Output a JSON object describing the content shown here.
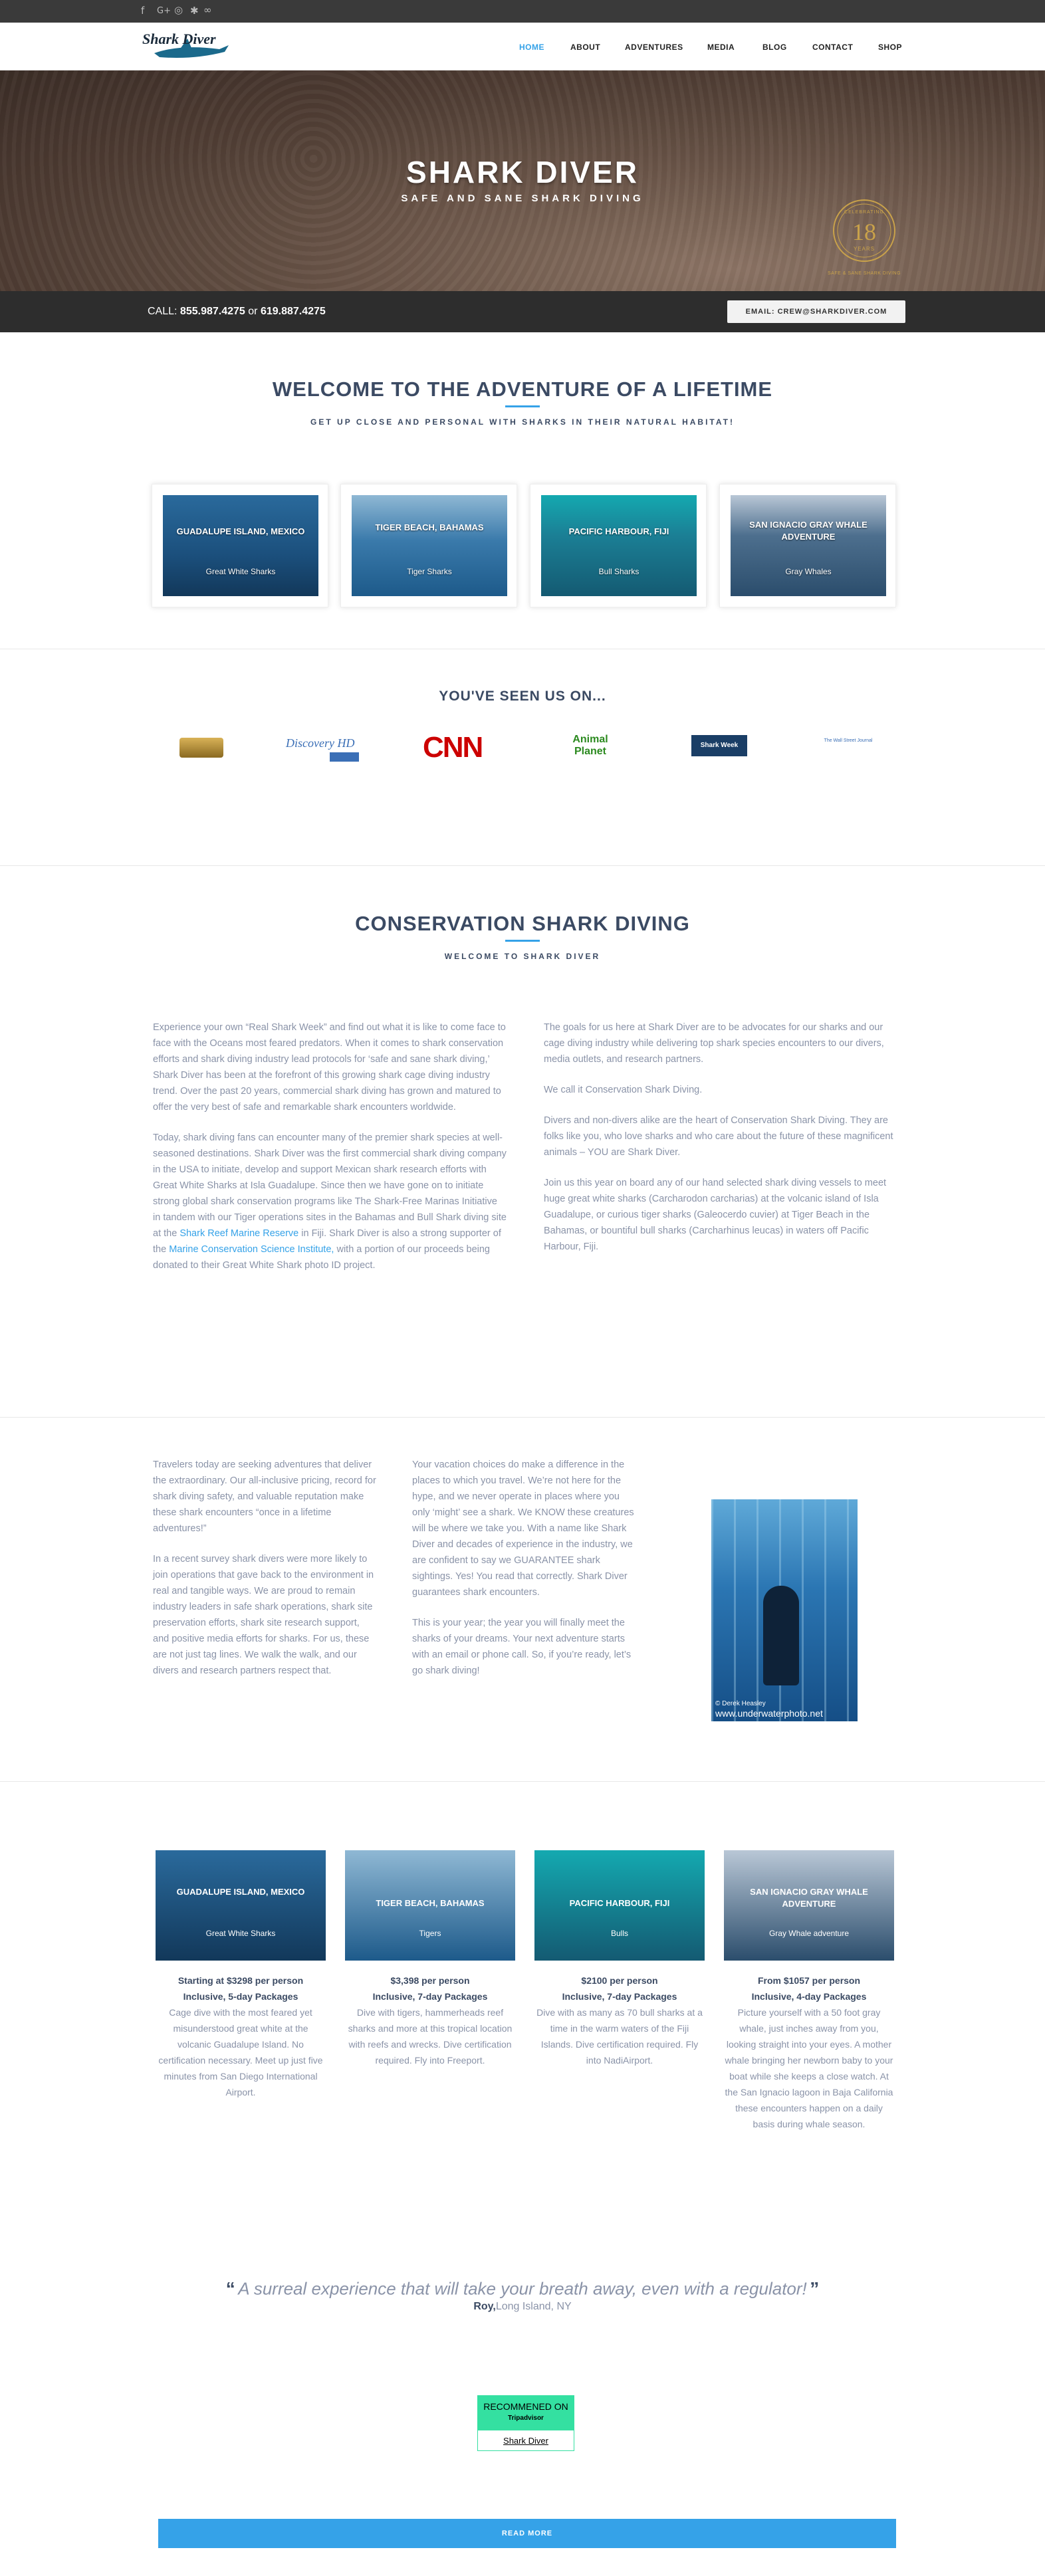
{
  "topbar": {
    "social_icons": [
      "facebook-icon",
      "google-plus-icon",
      "instagram-icon",
      "yelp-icon",
      "tripadvisor-icon"
    ]
  },
  "header": {
    "logo_text": "Shark Diver",
    "nav": [
      "HOME",
      "ABOUT",
      "ADVENTURES",
      "MEDIA",
      "BLOG",
      "CONTACT",
      "SHOP"
    ]
  },
  "hero": {
    "title": "SHARK DIVER",
    "subtitle": "SAFE AND SANE SHARK DIVING",
    "badge_top": "CELEBRATING",
    "badge_number": "18",
    "badge_years": "YEARS",
    "badge_bottom": "SAFE & SANE SHARK DIVING"
  },
  "callbar": {
    "call_label": "CALL:",
    "phone1": "855.987.4275",
    "or": "or",
    "phone2": "619.887.4275",
    "email_button": "EMAIL: CREW@SHARKDIVER.COM"
  },
  "welcome": {
    "title": "WELCOME TO THE ADVENTURE OF A LIFETIME",
    "subtitle": "GET UP CLOSE AND PERSONAL WITH SHARKS IN THEIR NATURAL HABITAT!"
  },
  "destinations": [
    {
      "title": "GUADALUPE ISLAND, MEXICO",
      "sub": "Great White Sharks"
    },
    {
      "title": "TIGER BEACH, BAHAMAS",
      "sub": "Tiger Sharks"
    },
    {
      "title": "PACIFIC HARBOUR, FIJI",
      "sub": "Bull Sharks"
    },
    {
      "title": "SAN IGNACIO GRAY WHALE ADVENTURE",
      "sub": "Gray Whales"
    }
  ],
  "seen": {
    "title": "YOU'VE SEEN US ON...",
    "logos": [
      "Discovery HD",
      "CNN",
      "Animal Planet",
      "Shark Week",
      "The Wall Street Journal"
    ]
  },
  "conservation": {
    "title": "CONSERVATION SHARK DIVING",
    "subtitle": "WELCOME TO SHARK DIVER",
    "left_p1": "Experience your own “Real Shark Week” and find out what it is like to come face to face with the Oceans most feared predators. When it comes to shark conservation efforts and shark diving industry lead protocols for ‘safe and sane shark diving,’ Shark Diver has been at the forefront of this growing shark cage diving industry trend. Over the past 20 years, commercial shark diving has grown and matured to offer the very best of safe and remarkable shark encounters worldwide.",
    "left_p2a": "Today, shark diving fans can encounter many of the premier shark species at well-seasoned destinations. Shark Diver was the first commercial shark diving company in the USA to initiate, develop and support Mexican shark research efforts with Great White Sharks at Isla Guadalupe. Since then we have gone on to initiate strong global shark conservation programs like The Shark-Free Marinas Initiative in tandem with our Tiger operations sites in the Bahamas and Bull Shark diving site at the",
    "link1": "Shark Reef Marine Reserve",
    "left_p2b": " in Fiji. Shark Diver is also a strong supporter of the ",
    "link2": "Marine Conservation Science Institute,",
    "left_p2c": " with a portion of our proceeds being donated to their Great White Shark photo ID project.",
    "right_p1": "The goals for us here at Shark Diver are to be advocates for our sharks and our cage diving industry while delivering top shark species encounters to our divers, media outlets, and research partners.",
    "right_p2": "We call it Conservation Shark Diving.",
    "right_p3": "Divers and non-divers alike are the heart of Conservation Shark Diving. They are folks like you, who love sharks and who care about the future of these magnificent animals – YOU are Shark Diver.",
    "right_p4": "Join us this year on board any of our hand selected shark diving vessels to meet huge great white sharks (Carcharodon carcharias) at the volcanic island of Isla Guadalupe, or curious tiger sharks (Galeocerdo cuvier) at Tiger Beach in the Bahamas, or bountiful bull sharks (Carcharhinus leucas) in waters off Pacific Harbour, Fiji."
  },
  "travel": {
    "c1_p1": "Travelers today are seeking adventures that deliver the extraordinary. Our all-inclusive pricing, record for shark diving safety, and valuable reputation make these shark encounters “once in a lifetime adventures!”",
    "c1_p2": "In a recent survey shark divers were more likely to join operations that gave back to the environment in real and tangible ways. We are proud to remain industry leaders in safe shark operations, shark site preservation efforts, shark site research support, and positive media efforts for sharks. For us, these are not just tag lines. We walk the walk, and our divers and research partners respect that.",
    "c2_p1": "Your vacation choices do make a difference in the places to which you travel. We’re not here for the hype, and we never operate in places where you only ‘might’ see a shark. We KNOW these creatures will be where we take you. With a name like Shark Diver and decades of experience in the industry, we are confident to say we GUARANTEE shark sightings. Yes! You read that correctly. Shark Diver guarantees shark encounters.",
    "c2_p2": "This is your year; the year you will finally meet the sharks of your dreams. Your next adventure starts with an email or phone call. So, if you’re ready, let’s go shark diving!",
    "photo_credit": "© Derek Heasley",
    "photo_url": "www.underwaterphoto.net"
  },
  "trips": [
    {
      "title": "GUADALUPE ISLAND, MEXICO",
      "sub": "Great White Sharks",
      "price": "Starting at $3298 per person",
      "pkg": "Inclusive, 5-day Packages",
      "desc": "Cage dive with the most feared yet misunderstood great white at the volcanic Guadalupe Island. No certification necessary. Meet up just five minutes from San Diego International Airport."
    },
    {
      "title": "TIGER BEACH, BAHAMAS",
      "sub": "Tigers",
      "price": "$3,398 per person",
      "pkg": "Inclusive, 7-day Packages",
      "desc": "Dive with tigers, hammerheads reef sharks and more at this tropical location with reefs and wrecks. Dive certification required. Fly into Freeport."
    },
    {
      "title": "PACIFIC HARBOUR, FIJI",
      "sub": "Bulls",
      "price": "$2100 per person",
      "pkg": "Inclusive, 7-day Packages",
      "desc": "Dive with as many as 70 bull sharks at a time in the warm waters of the Fiji Islands. Dive certification required. Fly into NadiAirport."
    },
    {
      "title": "SAN IGNACIO GRAY WHALE ADVENTURE",
      "sub": "Gray Whale adventure",
      "price": "From $1057 per person",
      "pkg": "Inclusive, 4-day Packages",
      "desc": "Picture yourself with a 50 foot gray whale, just inches away from you, looking straight into your eyes. A mother whale bringing her newborn baby to your boat while she keeps a close watch. At the San Ignacio lagoon in Baja California these encounters happen on a daily basis during whale season."
    }
  ],
  "testimonial": {
    "quote": "A surreal experience that will take your breath away, even with a regulator!",
    "name": "Roy,",
    "place": "Long Island, NY"
  },
  "tripadvisor": {
    "recommended": "RECOMMENED ON",
    "brand": "Tripadvisor",
    "link": "Shark Diver"
  },
  "readmore": "READ MORE",
  "colors": {
    "accent": "#35a2e8",
    "heading": "#3b4a63",
    "body": "#8a93a8"
  }
}
